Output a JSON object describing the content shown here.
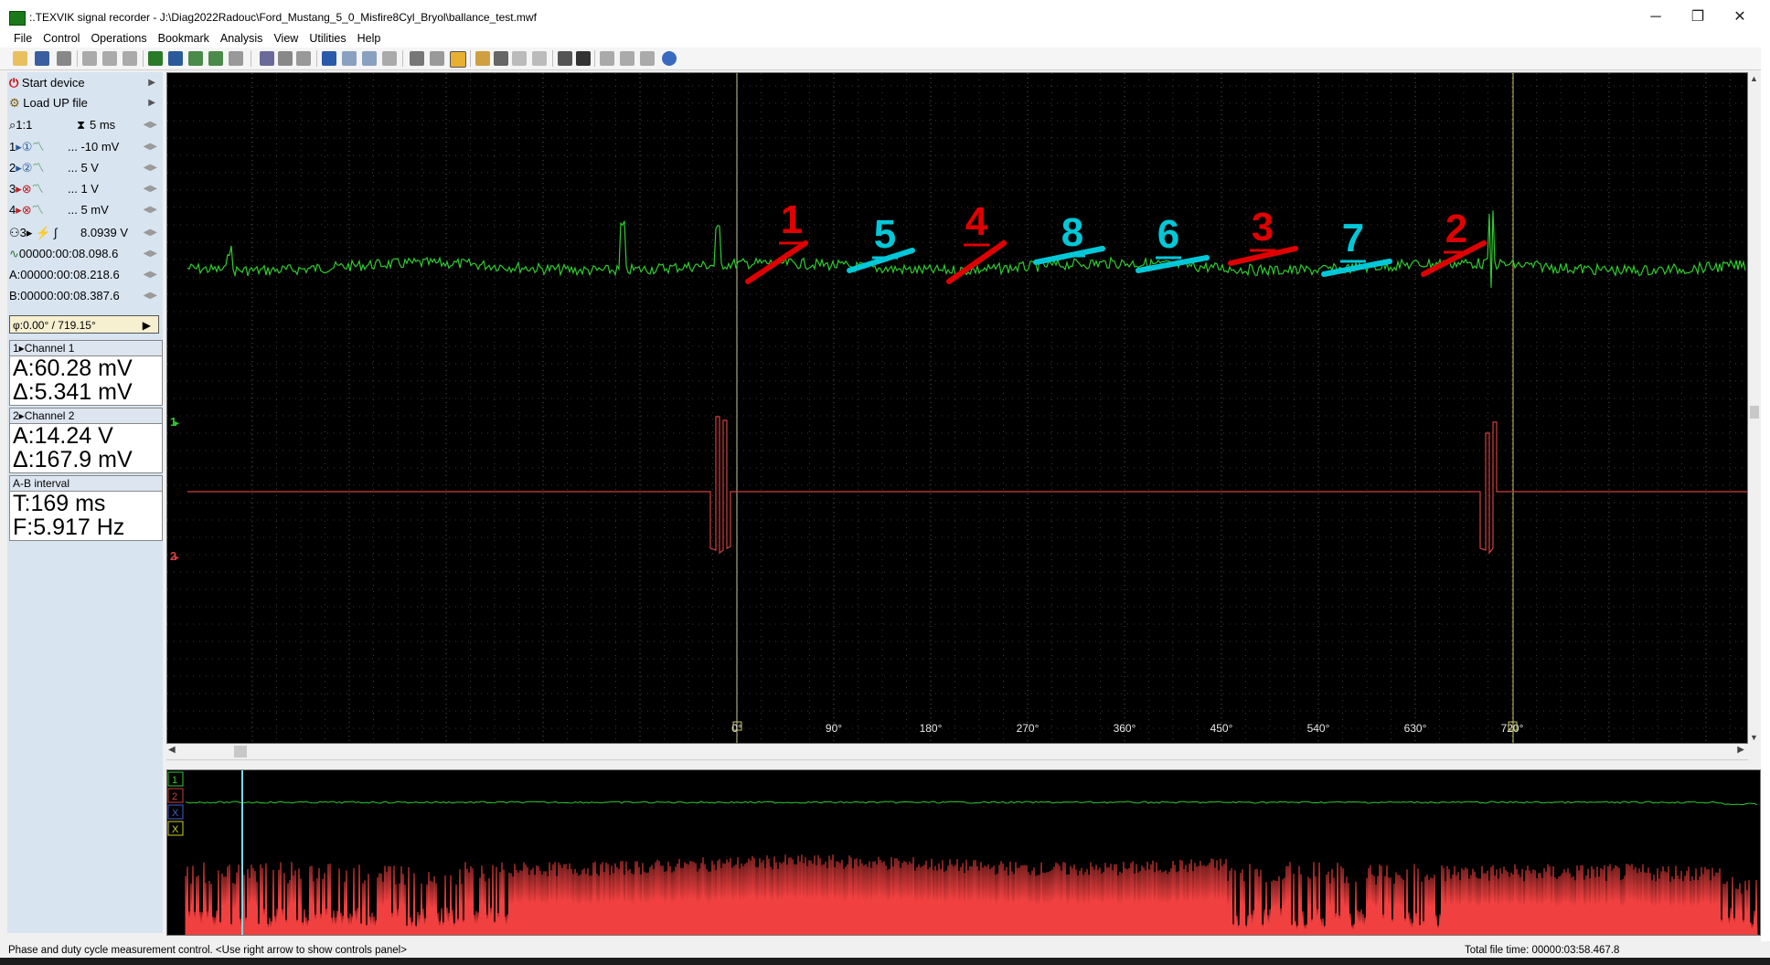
{
  "window": {
    "title": ":.TEXVIK  signal recorder  - J:\\Diag2022Radouc\\Ford_Mustang_5_0_Misfire8Cyl_Bryol\\ballance_test.mwf",
    "minimize": "─",
    "restore": "❐",
    "close": "✕"
  },
  "menu": [
    "File",
    "Control",
    "Operations",
    "Bookmark",
    "Analysis",
    "View",
    "Utilities",
    "Help"
  ],
  "panel": {
    "start_device": "Start device",
    "load_up_file": "Load UP file",
    "zoom": "1:1",
    "timebase": "5 ms",
    "channels": [
      {
        "num": "1",
        "range": "... -10 mV"
      },
      {
        "num": "2",
        "range": "... 5 V"
      },
      {
        "num": "3",
        "range": "... 1 V"
      },
      {
        "num": "4",
        "range": "... 5 mV"
      }
    ],
    "trigger_channel": "3",
    "trigger_level": "8.0939 V",
    "trigger_time": "00000:00:08.098.6",
    "cursor_a": "00000:00:08.218.6",
    "cursor_b": "00000:00:08.387.6",
    "phase": "0.00° / 719.15°",
    "ch1_header": "Channel 1",
    "ch1_a": "A:60.28 mV",
    "ch1_d": "Δ:5.341 mV",
    "ch2_header": "Channel 2",
    "ch2_a": "A:14.24 V",
    "ch2_d": "Δ:167.9 mV",
    "ab_header": "A-B interval",
    "ab_t": "T:169 ms",
    "ab_f": "F:5.917 Hz",
    "a_label": "A:",
    "b_label": "B:"
  },
  "scope": {
    "ch1_marker": "1",
    "ch2_marker": "2",
    "degrees": [
      "0°",
      "90°",
      "180°",
      "270°",
      "360°",
      "450°",
      "540°",
      "630°",
      "720°"
    ],
    "cylinders": [
      {
        "label": "1",
        "color": "#e00000"
      },
      {
        "label": "5",
        "color": "#00c8d8"
      },
      {
        "label": "4",
        "color": "#e00000"
      },
      {
        "label": "8",
        "color": "#00c8d8"
      },
      {
        "label": "6",
        "color": "#00c8d8"
      },
      {
        "label": "3",
        "color": "#e00000"
      },
      {
        "label": "7",
        "color": "#00c8d8"
      },
      {
        "label": "2",
        "color": "#e00000"
      }
    ],
    "trace1_color": "#2ecc2e",
    "trace2_color": "#d04040"
  },
  "overview": {
    "markers": [
      "1",
      "2",
      "X",
      "X"
    ]
  },
  "status": {
    "message": "Phase and duty cycle measurement control. <Use right arrow to show controls panel>",
    "total_time": "Total file time: 00000:03:58.467.8"
  }
}
